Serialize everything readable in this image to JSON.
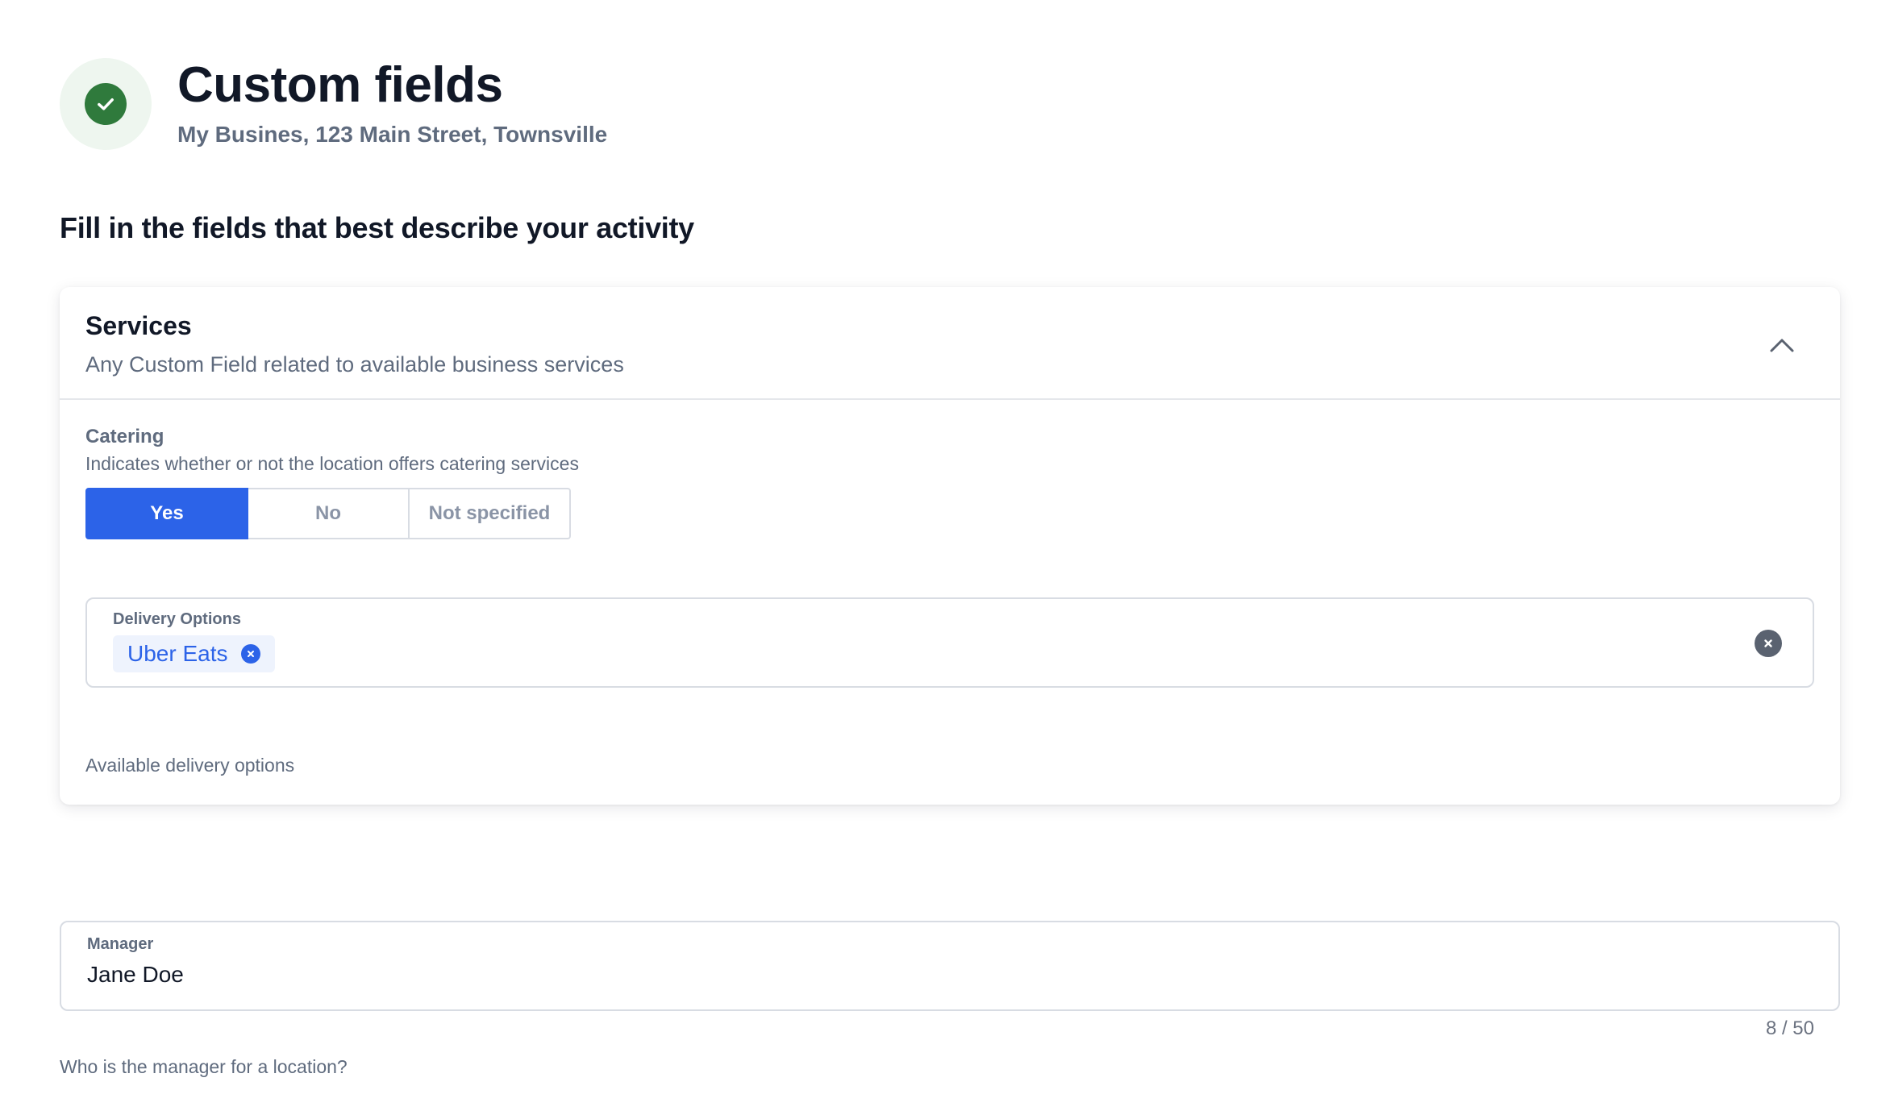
{
  "header": {
    "title": "Custom fields",
    "subtitle": "My Busines, 123 Main Street, Townsville",
    "status_icon": "check-icon",
    "status_color": "#2f7a3c"
  },
  "section_heading": "Fill in the fields that best describe your activity",
  "services_card": {
    "title": "Services",
    "description": "Any Custom Field related to available business services",
    "collapse_icon": "chevron-up-icon",
    "expanded": true,
    "catering": {
      "label": "Catering",
      "description": "Indicates whether or not the location offers catering services",
      "options": [
        "Yes",
        "No",
        "Not specified"
      ],
      "selected": "Yes"
    },
    "delivery": {
      "label": "Delivery Options",
      "chips": [
        "Uber Eats"
      ],
      "helper": "Available delivery options"
    }
  },
  "manager_field": {
    "label": "Manager",
    "value": "Jane Doe",
    "counter": "8 / 50",
    "helper": "Who is the manager for a location?"
  },
  "colors": {
    "accent": "#2c63e8",
    "success": "#2f7a3c",
    "muted_text": "#5f6b7e",
    "border": "#d8dce3"
  }
}
